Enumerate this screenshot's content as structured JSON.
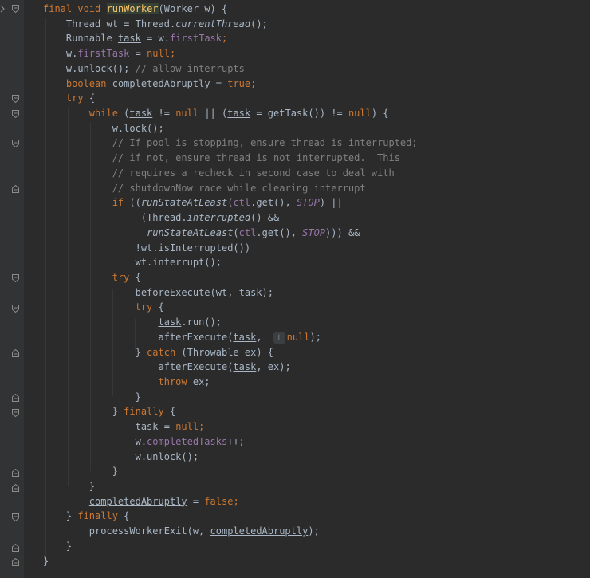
{
  "editor": {
    "language": "java",
    "colors": {
      "background": "#2b2b2b",
      "gutter": "#313335",
      "keyword": "#cc7832",
      "method_decl": "#ffc66d",
      "field": "#9876aa",
      "comment": "#808080",
      "text": "#a9b7c6"
    },
    "lines": [
      "final void runWorker(Worker w) {",
      "Thread wt = Thread.currentThread();",
      "Runnable task = w.firstTask;",
      "w.firstTask = null;",
      "w.unlock(); // allow interrupts",
      "boolean completedAbruptly = true;",
      "try {",
      "while (task != null || (task = getTask()) != null) {",
      "w.lock();",
      "// If pool is stopping, ensure thread is interrupted;",
      "// if not, ensure thread is not interrupted.  This",
      "// requires a recheck in second case to deal with",
      "// shutdownNow race while clearing interrupt",
      "if ((runStateAtLeast(ctl.get(), STOP) ||",
      "(Thread.interrupted() &&",
      "runStateAtLeast(ctl.get(), STOP))) &&",
      "!wt.isInterrupted())",
      "wt.interrupt();",
      "try {",
      "beforeExecute(wt, task);",
      "try {",
      "task.run();",
      "afterExecute(task, t null);",
      "} catch (Throwable ex) {",
      "afterExecute(task, ex);",
      "throw ex;",
      "}",
      "} finally {",
      "task = null;",
      "w.completedTasks++;",
      "w.unlock();",
      "}",
      "}",
      "} finally {",
      "processWorkerExit(w, completedAbruptly);",
      "}",
      "}"
    ],
    "tokens": {
      "final": "final",
      "void": "void",
      "runWorker": "runWorker",
      "params": "(Worker w) {",
      "thread_decl": "Thread wt = Thread.",
      "currentThread": "currentThread",
      "call_end": "();",
      "runnable": "Runnable ",
      "task": "task",
      "eq_w": " = w.",
      "firstTask": "firstTask",
      "semi": ";",
      "w_dot": "w.",
      "eq": " = ",
      "null": "null",
      "unlock_call": "w.unlock();",
      "comment_allow": " // allow interrupts",
      "boolean": "boolean",
      "completedAbruptly": "completedAbruptly",
      "true": "true",
      "try": "try",
      "brace_open": " {",
      "while": "while",
      "paren": " (",
      "neq": " != ",
      "or_paren": " || (",
      "gettask": " = getTask()) != ",
      "paren_brace": ") {",
      "lock_call": "w.lock();",
      "c1": "// If pool is stopping, ensure thread is interrupted;",
      "c2": "// if not, ensure thread is not interrupted.  This",
      "c3": "// requires a recheck in second case to deal with",
      "c4": "// shutdownNow race while clearing interrupt",
      "if": "if",
      "paren2": " ((",
      "runStateAtLeast": "runStateAtLeast",
      "paren_open": "(",
      "ctl": "ctl",
      "get_call": ".get(), ",
      "STOP": "STOP",
      "or_end": ") ||",
      "thread_paren": "(Thread.",
      "interrupted": "interrupted",
      "and_end": "() &&",
      "close_and": "))) &&",
      "not_interrupted": "!wt.isInterrupted())",
      "interrupt_call": "wt.interrupt();",
      "before": "beforeExecute(wt, ",
      "close_semi": ");",
      "run_call": ".run();",
      "after": "afterExecute(",
      "comma": ", ",
      "hint_t": "t",
      "close_brace": "}",
      "close_brace_sp": "} ",
      "catch": "catch",
      "throwable": " (Throwable ex) {",
      "ex_end": ", ex);",
      "throw": "throw",
      "ex_semi": " ex;",
      "finally": "finally",
      "eq_null": " = ",
      "completedTasks": "completedTasks",
      "plusplus": "++;",
      "false": "false",
      "process": "processWorkerExit(w, ",
      "w_comma": "w, ",
      "worker_param": "Worker",
      "w_param": "w"
    }
  }
}
